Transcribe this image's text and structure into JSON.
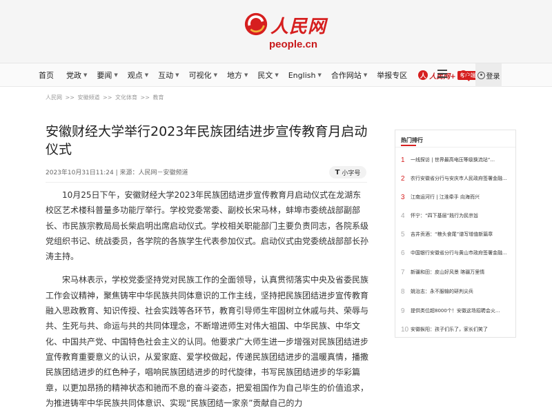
{
  "brand": {
    "logo_cn": "人民网",
    "logo_en": "people.cn",
    "accent": "#d61f1f"
  },
  "nav": {
    "items": [
      {
        "label": "首页",
        "caret": false
      },
      {
        "label": "党政",
        "caret": true
      },
      {
        "label": "要闻",
        "caret": true
      },
      {
        "label": "观点",
        "caret": true
      },
      {
        "label": "互动",
        "caret": true
      },
      {
        "label": "可视化",
        "caret": true
      },
      {
        "label": "地方",
        "caret": true
      },
      {
        "label": "民文",
        "caret": true
      },
      {
        "label": "English",
        "caret": true
      },
      {
        "label": "合作网站",
        "caret": true
      },
      {
        "label": "举报专区",
        "caret": false
      }
    ],
    "app_name": "人民网+",
    "app_tag": "客户端",
    "login_label": "登录",
    "icons": [
      "menu-icon",
      "search-icon",
      "user-icon"
    ]
  },
  "breadcrumb": [
    "人民网",
    ">>",
    "安徽频道",
    ">>",
    "文化体育",
    ">>",
    "教育"
  ],
  "article": {
    "title": "安徽财经大学举行2023年民族团结进步宣传教育月启动仪式",
    "meta": "2023年10月31日11:24 | 来源：人民网－安徽频道",
    "font_button": "小字号",
    "paragraphs": [
      "10月25日下午，安徽财经大学2023年民族团结进步宣传教育月启动仪式在龙湖东校区艺术楼科普量多功能厅举行。学校党委常委、副校长宋马林，蚌埠市委统战部副部长、市民族宗教局局长柴启明出席启动仪式。学校相关职能部门主要负责同志，各院系级党组织书记、统战委员，各学院的各族学生代表参加仪式。启动仪式由党委统战部部长孙涛主持。",
      "宋马林表示，学校党委坚持党对民族工作的全面领导，认真贯彻落实中央及省委民族工作会议精神，聚焦铸牢中华民族共同体意识的工作主线，坚持把民族团结进步宣传教育融入思政教育、知识传授、社会实践等各环节，教育引导师生牢固树立休戚与共、荣辱与共、生死与共、命运与共的共同体理念，不断增进师生对伟大祖国、中华民族、中华文化、中国共产党、中国特色社会主义的认同。他要求广大师生进一步增强对民族团结进步宣传教育重要意义的认识，从爱家庭、爱学校做起，传递民族团结进步的温暖真情，播撒民族团结进步的红色种子，唱响民族团结进步的时代旋律，书写民族团结进步的华彩篇章，以更加昂扬的精神状态和驰而不息的奋斗姿态，把爱祖国作为自己毕生的价值追求，为推进铸牢中华民族共同体意识、实现“民族团结一家亲”贡献自己的力"
    ]
  },
  "sidebar": {
    "title": "热门排行",
    "items": [
      {
        "num": "1",
        "text": "一线探访 | 世界最高电压等级换流站“..."
      },
      {
        "num": "2",
        "text": "农行安徽省分行与安庆市人民政府签署金融..."
      },
      {
        "num": "3",
        "text": "江南运河行 | 江淮牵手 向海而兴"
      },
      {
        "num": "4",
        "text": "怀宁：“四下基层”践行为民宗旨"
      },
      {
        "num": "5",
        "text": "吉井贡酒：“粮头食尾”谱写增值新篇章"
      },
      {
        "num": "6",
        "text": "中国银行安徽省分行与黄山市政府签署金融..."
      },
      {
        "num": "7",
        "text": "新疆和田：皮山好风景 喀疆万里情"
      },
      {
        "num": "8",
        "text": "姚治志：永不服输的研判尖兵"
      },
      {
        "num": "9",
        "text": "提供类位超8000个！安徽这场招聘会火..."
      },
      {
        "num": "10",
        "text": "安徽枞阳：孩子们乐了，家长们笑了"
      }
    ]
  }
}
